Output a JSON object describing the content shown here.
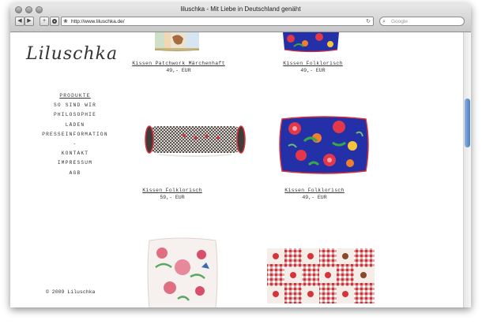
{
  "window": {
    "title": "liluschka - Mit Liebe in Deutschland genäht"
  },
  "toolbar": {
    "back_label": "◀",
    "forward_label": "▶",
    "add_label": "+",
    "url": "http://www.liluschka.de/",
    "search_placeholder": "Google"
  },
  "site": {
    "logo": "Liluschka",
    "nav": [
      "PRODUKTE",
      "SO SIND WIR",
      "PHILOSOPHIE",
      "LÄDEN",
      "PRESSEINFORMATION",
      "-",
      "KONTAKT",
      "IMPRESSUM",
      "AGB"
    ],
    "footer": "© 2009 Liluschka"
  },
  "products": [
    {
      "name": "Kissen Patchwork Märchenhaft",
      "price": "49,- EUR"
    },
    {
      "name": "Kissen Folklorisch",
      "price": "49,- EUR"
    },
    {
      "name": "Kissen Folklorisch",
      "price": "59,- EUR"
    },
    {
      "name": "Kissen Folklorisch",
      "price": "49,- EUR"
    }
  ],
  "colors": {
    "accent_red": "#d9323a",
    "folk_blue": "#2330a8",
    "page_bg": "#ffffff"
  }
}
